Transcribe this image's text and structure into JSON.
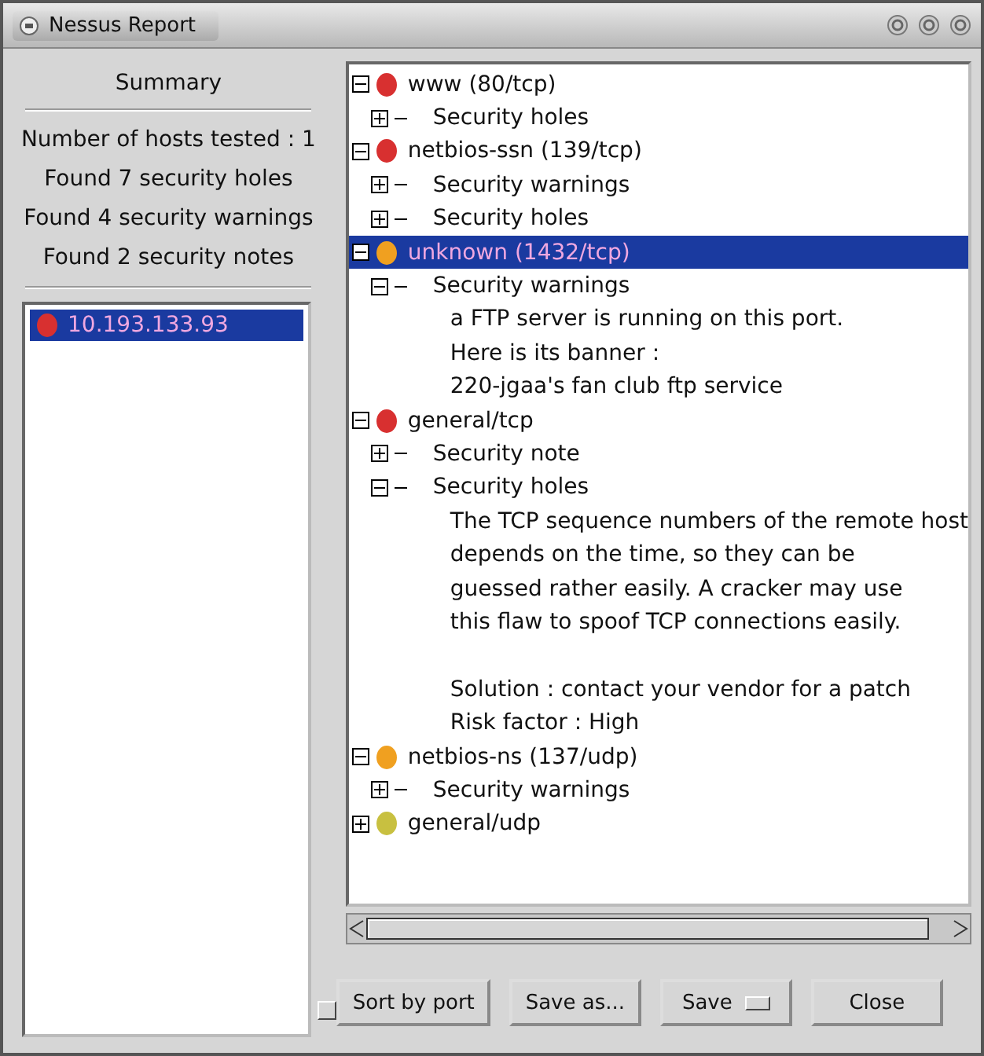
{
  "window": {
    "title": "Nessus Report"
  },
  "summary": {
    "title": "Summary",
    "lines": [
      "Number of hosts tested : 1",
      "Found 7 security holes",
      "Found 4 security warnings",
      "Found 2 security notes"
    ]
  },
  "hosts": [
    {
      "label": "10.193.133.93",
      "color": "#d83030",
      "selected": true
    }
  ],
  "ports": [
    {
      "label": "www (80/tcp)",
      "color": "#d83030",
      "expanded": true,
      "selected": false,
      "children": [
        {
          "label": "Security holes",
          "expanded": false
        }
      ]
    },
    {
      "label": "netbios-ssn (139/tcp)",
      "color": "#d83030",
      "expanded": true,
      "selected": false,
      "children": [
        {
          "label": "Security warnings",
          "expanded": false
        },
        {
          "label": "Security holes",
          "expanded": false
        }
      ]
    },
    {
      "label": "unknown (1432/tcp)",
      "color": "#f0a020",
      "expanded": true,
      "selected": true,
      "children": [
        {
          "label": "Security warnings",
          "expanded": true,
          "paragraphs": [
            [
              "a FTP server is running on this port.",
              "Here is its banner :",
              "220-jgaa's fan club ftp service"
            ]
          ]
        }
      ]
    },
    {
      "label": "general/tcp",
      "color": "#d83030",
      "expanded": true,
      "selected": false,
      "children": [
        {
          "label": "Security note",
          "expanded": false
        },
        {
          "label": "Security holes",
          "expanded": true,
          "paragraphs": [
            [
              "The TCP sequence numbers of the remote host",
              "depends on the time, so they can be",
              "guessed rather easily. A cracker may use",
              "this flaw to spoof TCP connections easily."
            ],
            [
              "Solution : contact your vendor for a patch",
              "Risk factor : High"
            ]
          ]
        }
      ]
    },
    {
      "label": "netbios-ns (137/udp)",
      "color": "#f0a020",
      "expanded": true,
      "selected": false,
      "children": [
        {
          "label": "Security warnings",
          "expanded": false
        }
      ]
    },
    {
      "label": "general/udp",
      "color": "#c8c040",
      "expanded": false,
      "selected": false
    }
  ],
  "sort_by_port": {
    "label": "Sort by port",
    "checked": false
  },
  "buttons": [
    {
      "kind": "button",
      "label": "Save as..."
    },
    {
      "kind": "menu",
      "label": "Save"
    },
    {
      "kind": "button",
      "label": "Close"
    }
  ]
}
